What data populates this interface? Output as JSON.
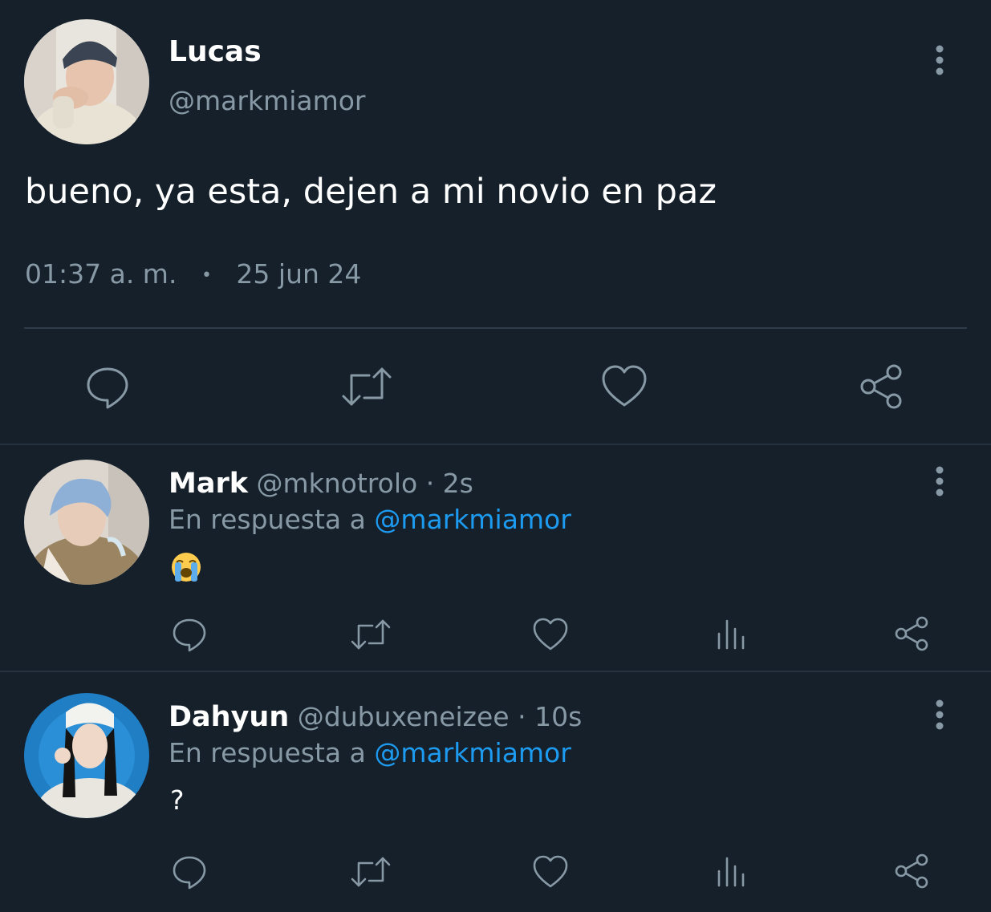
{
  "main_tweet": {
    "author": {
      "name": "Lucas",
      "handle": "@markmiamor"
    },
    "text": "bueno, ya esta, dejen a mi novio en paz",
    "time": "01:37 a. m.",
    "separator": "•",
    "date": "25 jun 24",
    "actions": [
      "reply-icon",
      "retweet-icon",
      "like-icon",
      "share-icon"
    ]
  },
  "replies": [
    {
      "name": "Mark",
      "handle": "@mknotrolo",
      "age": "· 2s",
      "reply_prefix": "En respuesta a",
      "reply_to": "@markmiamor",
      "text": "😭",
      "actions": [
        "reply-icon",
        "retweet-icon",
        "like-icon",
        "analytics-icon",
        "share-icon"
      ]
    },
    {
      "name": "Dahyun",
      "handle": "@dubuxeneizee",
      "age": "· 10s",
      "reply_prefix": "En respuesta a",
      "reply_to": "@markmiamor",
      "text": "?",
      "actions": [
        "reply-icon",
        "retweet-icon",
        "like-icon",
        "analytics-icon",
        "share-icon"
      ]
    }
  ],
  "colors": {
    "background": "#15202b",
    "muted": "#8899a6",
    "link": "#1d9bf0",
    "divider": "#253341"
  }
}
